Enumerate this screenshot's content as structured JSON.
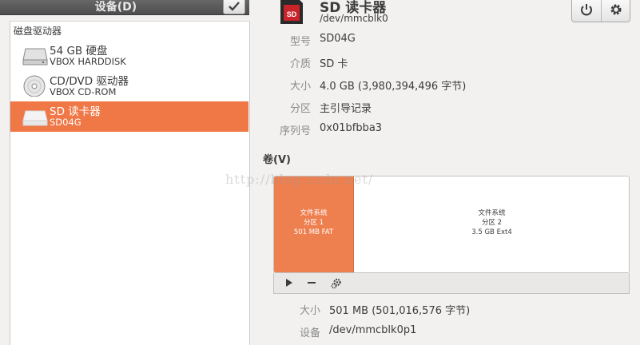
{
  "header": {
    "title": "设备(D)"
  },
  "sidebar": {
    "section_label": "磁盘驱动器",
    "items": [
      {
        "name": "54 GB 硬盘",
        "subtitle": "VBOX HARDDISK",
        "icon": "hard-disk-icon"
      },
      {
        "name": "CD/DVD 驱动器",
        "subtitle": "VBOX CD-ROM",
        "icon": "optical-disc-icon"
      },
      {
        "name": "SD 读卡器",
        "subtitle": "SD04G",
        "icon": "sd-card-reader-icon",
        "selected": true
      }
    ]
  },
  "device": {
    "title": "SD 读卡器",
    "path": "/dev/mmcblk0",
    "properties": [
      {
        "label": "型号",
        "value": "SD04G"
      },
      {
        "label": "介质",
        "value": "SD 卡"
      },
      {
        "label": "大小",
        "value": "4.0 GB (3,980,394,496 字节)"
      },
      {
        "label": "分区",
        "value": "主引导记录"
      },
      {
        "label": "序列号",
        "value": "0x01bfbba3"
      }
    ]
  },
  "volumes": {
    "label": "卷(V)",
    "partitions": [
      {
        "line1": "文件系统",
        "line2": "分区 1",
        "line3": "501 MB FAT",
        "selected": true
      },
      {
        "line1": "文件系统",
        "line2": "分区 2",
        "line3": "3.5 GB Ext4",
        "selected": false
      }
    ],
    "toolbar": [
      "play-icon",
      "minus-icon",
      "gears-icon"
    ]
  },
  "volume_details": [
    {
      "label": "大小",
      "value": "501 MB (501,016,576 字节)"
    },
    {
      "label": "设备",
      "value": "/dev/mmcblk0p1"
    }
  ],
  "watermark": "http://blog.csdn.net/",
  "colors": {
    "accent": "#f07746",
    "partition_selected": "#ee8050",
    "header_bg": "#5a5a5a"
  }
}
